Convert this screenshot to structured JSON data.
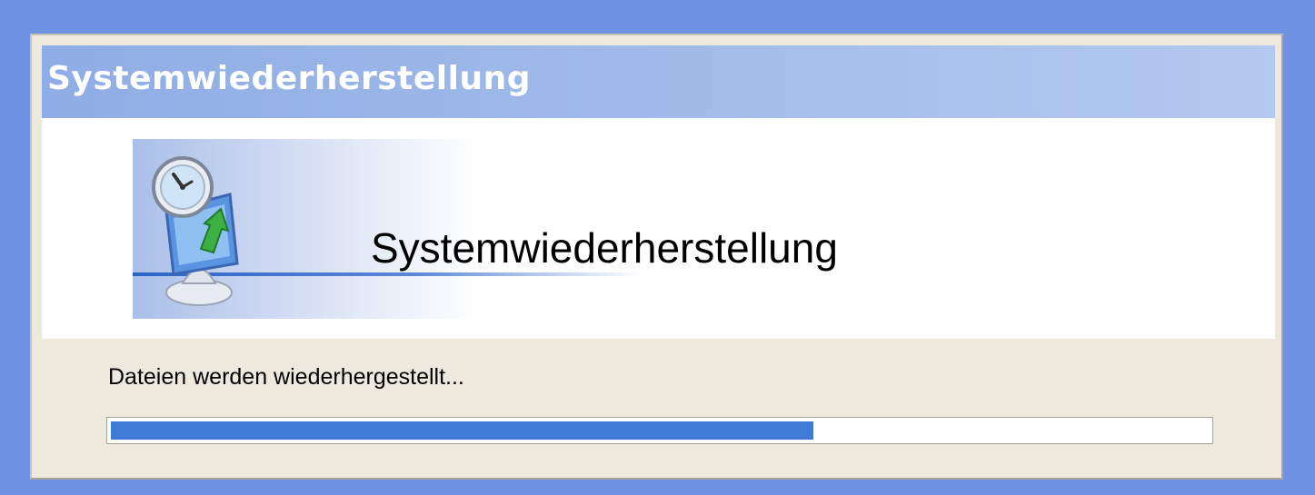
{
  "window": {
    "title": "Systemwiederherstellung"
  },
  "banner": {
    "title": "Systemwiederherstellung",
    "icon": "system-restore-icon"
  },
  "status": {
    "text": "Dateien werden wiederhergestellt..."
  },
  "progress": {
    "fraction": 0.64
  },
  "colors": {
    "desktop": "#6f93e2",
    "titlebar": "#9fbae9",
    "dialog": "#ede9dd",
    "progress_fill": "#3f7ad4"
  }
}
